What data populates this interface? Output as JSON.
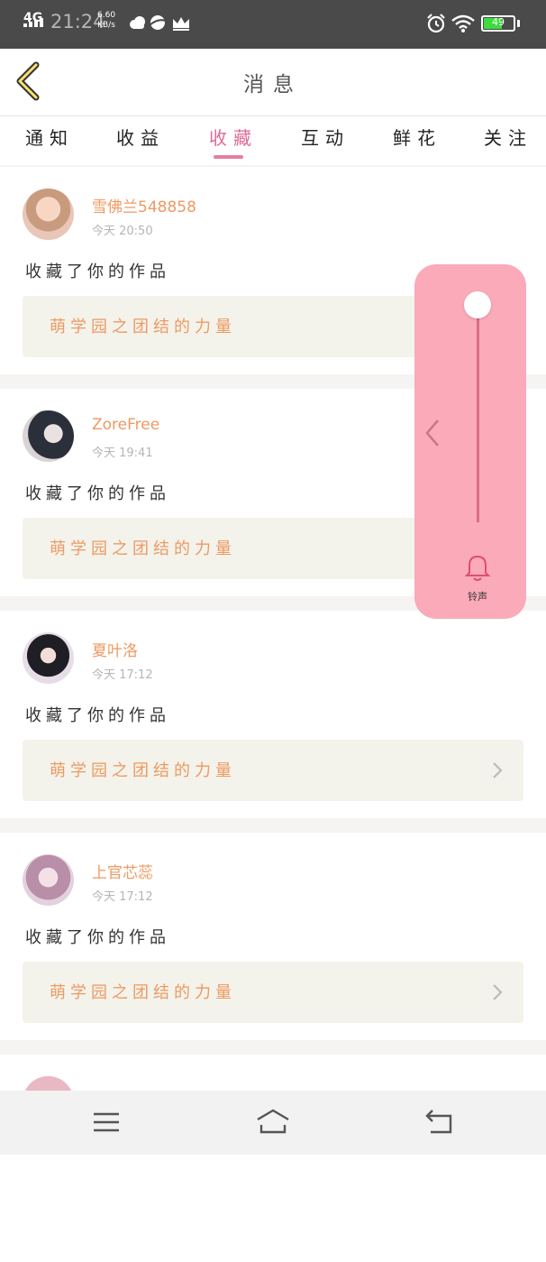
{
  "status_bar": {
    "network": "4G",
    "time": "21:24",
    "speed_value": "6.60",
    "speed_unit": "KB/s",
    "battery": "49",
    "icons": [
      "cloud-icon",
      "planet-icon",
      "crown-icon",
      "alarm-icon",
      "wifi-icon",
      "battery-icon"
    ]
  },
  "header": {
    "title": "消息",
    "back_icon": "chevron-left-icon"
  },
  "tabs": [
    {
      "label": "通知",
      "active": false
    },
    {
      "label": "收益",
      "active": false
    },
    {
      "label": "收藏",
      "active": true
    },
    {
      "label": "互动",
      "active": false
    },
    {
      "label": "鲜花",
      "active": false
    },
    {
      "label": "关注",
      "active": false
    }
  ],
  "items": [
    {
      "name": "雪佛兰548858",
      "time": "今天 20:50",
      "action": "收藏了你的作品",
      "work": "萌学园之团结的力量"
    },
    {
      "name": "ZoreFree",
      "time": "今天 19:41",
      "action": "收藏了你的作品",
      "work": "萌学园之团结的力量"
    },
    {
      "name": "夏叶洛",
      "time": "今天 17:12",
      "action": "收藏了你的作品",
      "work": "萌学园之团结的力量"
    },
    {
      "name": "上官芯蕊",
      "time": "今天 17:12",
      "action": "收藏了你的作品",
      "work": "萌学园之团结的力量"
    }
  ],
  "volume_panel": {
    "label": "铃声",
    "level": 1.0
  },
  "colors": {
    "accent": "#e06a95",
    "name": "#ee9a62",
    "panel": "#fbaab9"
  }
}
